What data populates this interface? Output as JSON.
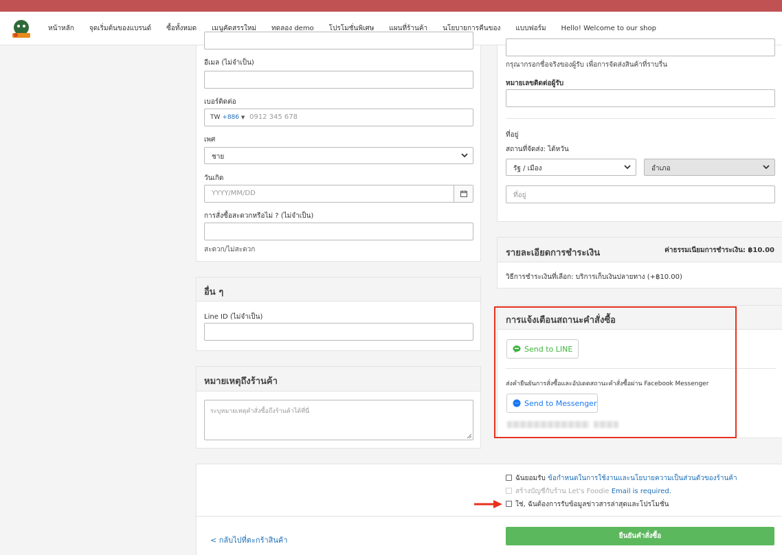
{
  "nav": {
    "items": [
      "หน้าหลัก",
      "จุดเริ่มต้นของแบรนด์",
      "ซื้อทั้งหมด",
      "เมนูคัดสรรใหม่",
      "ทดลอง demo",
      "โปรโมชั่นพิเศษ",
      "แผนที่ร้านค้า",
      "นโยบายการคืนของ",
      "แบบฟอร์ม",
      "Hello! Welcome to our shop"
    ]
  },
  "customer": {
    "email_label": "อีเมล (ไม่จำเป็น)",
    "phone_label": "เบอร์ติดต่อ",
    "phone_country": "TW",
    "phone_code": "+886",
    "phone_placeholder": "0912 345 678",
    "gender_label": "เพศ",
    "gender_value": "ชาย",
    "birthday_label": "วันเกิด",
    "birthday_placeholder": "YYYY/MM/DD",
    "convenient_label": "การสั่งซื้อสะดวกหรือไม่ ? (ไม่จำเป็น)",
    "convenient_hint": "สะดวก/ไม่สะดวก"
  },
  "other": {
    "title": "อื่น ๆ",
    "line_id_label": "Line ID (ไม่จำเป็น)"
  },
  "note": {
    "title": "หมายเหตุถึงร้านค้า",
    "placeholder": "ระบุหมายเหตุคำสั่งซื้อถึงร้านค้าได้ที่นี่"
  },
  "recipient": {
    "name_hint": "กรุณากรอกชื่อจริงของผู้รับ เพื่อการจัดส่งสินค้าที่ราบรื่น",
    "phone_label": "หมายเลขติดต่อผู้รับ",
    "address_label": "ที่อยู่",
    "shipping_place": "สถานที่จัดส่ง: ไต้หวัน",
    "state_value": "รัฐ / เมือง",
    "district_value": "อำเภอ",
    "address_placeholder": "ที่อยู่"
  },
  "payment": {
    "title": "รายละเอียดการชำระเงิน",
    "fee": "ค่าธรรมเนียมการชำระเงิน: ฿10.00",
    "method": "วิธีการชำระเงินที่เลือก: บริการเก็บเงินปลายทาง (+฿10.00)"
  },
  "notify": {
    "title": "การแจ้งเตือนสถานะคำสั่งซื้อ",
    "line_button": "Send to LINE",
    "messenger_desc": "ส่งคำยืนยันการสั่งซื้อและอัปเดตสถานะคำสั่งซื้อผ่าน Facebook Messenger",
    "messenger_button": "Send to Messenger"
  },
  "consent": {
    "terms_prefix": "ฉันยอมรับ ",
    "terms_link": "ข้อกำหนดในการใช้งานและนโยบายความเป็นส่วนตัวของร้านค้า",
    "account_text": "สร้างบัญชีกับร้าน Let's Foodie ",
    "account_error": "Email is required.",
    "newsletter": "ใช่, ฉันต้องการรับข้อมูลข่าวสารล่าสุดและโปรโมชั่น"
  },
  "footer": {
    "back_link": "< กลับไปที่ตะกร้าสินค้า",
    "confirm_button": "ยืนยันคำสั่งซื้อ"
  },
  "colors": {
    "topbar": "#c15253",
    "confirm": "#5cb85c",
    "highlight": "#e8311f",
    "link": "#1d6fb7",
    "line_green": "#3cb33c",
    "messenger_blue": "#1877f2"
  }
}
